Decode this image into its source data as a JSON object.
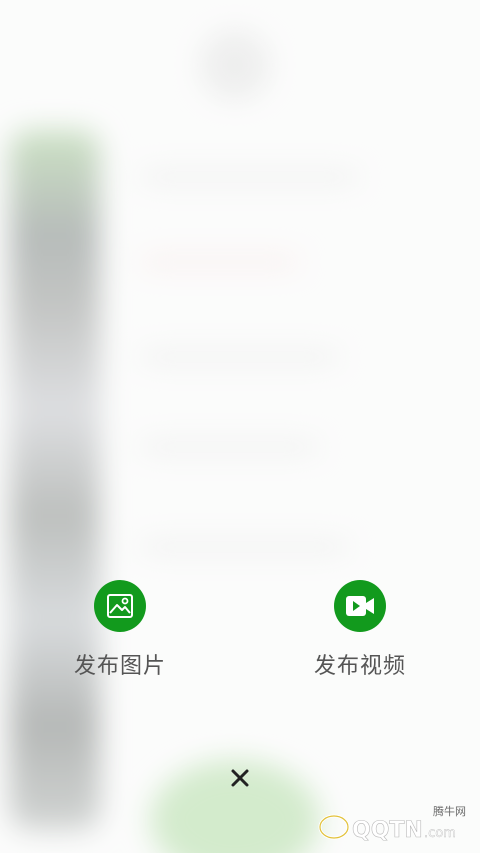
{
  "publish_menu": {
    "photo_label": "发布图片",
    "video_label": "发布视频"
  },
  "colors": {
    "accent_green": "#129a1d",
    "label_gray": "#555555"
  },
  "icons": {
    "photo": "image-icon",
    "video": "video-camera-icon",
    "close": "close-icon"
  },
  "watermark": {
    "brand": "QQTN.com",
    "site": "腾牛网"
  }
}
